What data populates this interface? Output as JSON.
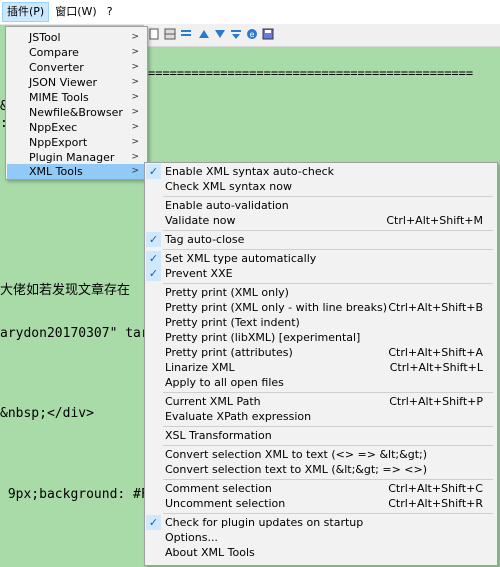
{
  "menubar": {
    "plugins": "插件(P)",
    "window": "窗口(W)",
    "help": "?"
  },
  "editor": {
    "lines": [
      "=============================================",
      "&",
      ":",
      "大佬如若发现文章存在",
      "arydon20170307\" tar",
      "&nbsp;</div>",
      " 9px;background: #F"
    ]
  },
  "plugins_menu": {
    "items": [
      {
        "label": "JSTool"
      },
      {
        "label": "Compare"
      },
      {
        "label": "Converter"
      },
      {
        "label": "JSON Viewer"
      },
      {
        "label": "MIME Tools"
      },
      {
        "label": "Newfile&Browser"
      },
      {
        "label": "NppExec"
      },
      {
        "label": "NppExport"
      },
      {
        "label": "Plugin Manager"
      },
      {
        "label": "XML Tools"
      }
    ],
    "arrow": ">"
  },
  "xml_tools_menu": {
    "check_glyph": "✓",
    "items": [
      {
        "label": "Enable XML syntax auto-check",
        "shortcut": "",
        "checked": true
      },
      {
        "label": "Check XML syntax now",
        "shortcut": "",
        "checked": false
      },
      {
        "label": "Enable auto-validation",
        "shortcut": "",
        "checked": false
      },
      {
        "label": "Validate now",
        "shortcut": "Ctrl+Alt+Shift+M",
        "checked": false
      },
      {
        "label": "Tag auto-close",
        "shortcut": "",
        "checked": true
      },
      {
        "label": "Set XML type automatically",
        "shortcut": "",
        "checked": true
      },
      {
        "label": "Prevent XXE",
        "shortcut": "",
        "checked": true
      },
      {
        "label": "Pretty print (XML only)",
        "shortcut": "",
        "checked": false
      },
      {
        "label": "Pretty print (XML only - with line breaks)",
        "shortcut": "Ctrl+Alt+Shift+B",
        "checked": false
      },
      {
        "label": "Pretty print (Text indent)",
        "shortcut": "",
        "checked": false
      },
      {
        "label": "Pretty print (libXML) [experimental]",
        "shortcut": "",
        "checked": false
      },
      {
        "label": "Pretty print (attributes)",
        "shortcut": "Ctrl+Alt+Shift+A",
        "checked": false
      },
      {
        "label": "Linarize XML",
        "shortcut": "Ctrl+Alt+Shift+L",
        "checked": false
      },
      {
        "label": "Apply to all open files",
        "shortcut": "",
        "checked": false
      },
      {
        "label": "Current XML Path",
        "shortcut": "Ctrl+Alt+Shift+P",
        "checked": false
      },
      {
        "label": "Evaluate XPath expression",
        "shortcut": "",
        "checked": false
      },
      {
        "label": "XSL Transformation",
        "shortcut": "",
        "checked": false
      },
      {
        "label": "Convert selection XML to text (<> => &lt;&gt;)",
        "shortcut": "",
        "checked": false
      },
      {
        "label": "Convert selection text to XML (&lt;&gt; => <>)",
        "shortcut": "",
        "checked": false
      },
      {
        "label": "Comment selection",
        "shortcut": "Ctrl+Alt+Shift+C",
        "checked": false
      },
      {
        "label": "Uncomment selection",
        "shortcut": "Ctrl+Alt+Shift+R",
        "checked": false
      },
      {
        "label": "Check for plugin updates on startup",
        "shortcut": "",
        "checked": true
      },
      {
        "label": "Options...",
        "shortcut": "",
        "checked": false
      },
      {
        "label": "About XML Tools",
        "shortcut": "",
        "checked": false
      }
    ]
  },
  "colors": {
    "editor_bg": "#a8dba8",
    "menu_bg": "#f2f2f2",
    "highlight": "#91c9f7",
    "check_bg": "#cfe8fc"
  }
}
